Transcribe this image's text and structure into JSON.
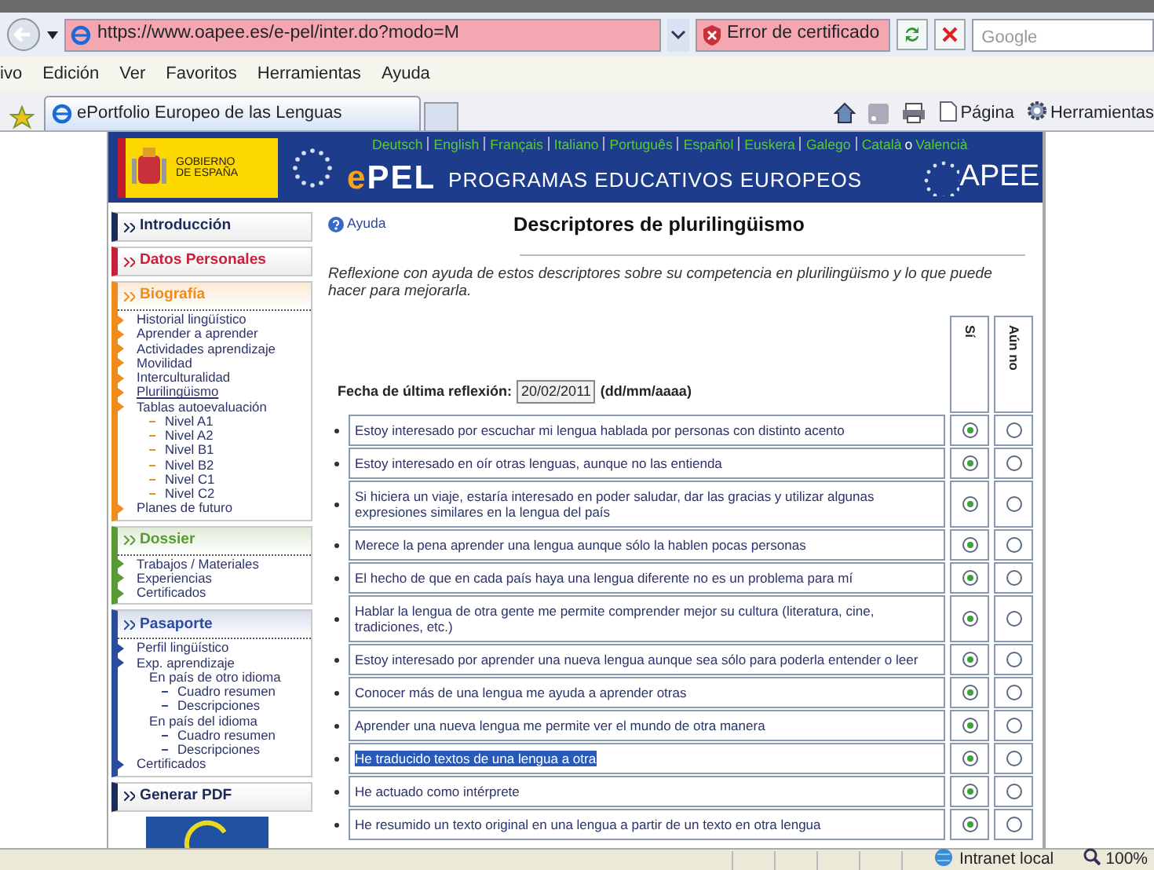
{
  "browser": {
    "address": "https://www.oapee.es/e-pel/inter.do?modo=M",
    "cert_error": "Error de certificado",
    "search_placeholder": "Google",
    "menu": [
      "ivo",
      "Edición",
      "Ver",
      "Favoritos",
      "Herramientas",
      "Ayuda"
    ],
    "tab_title": "ePortfolio Europeo de las Lenguas",
    "toolbar": [
      "Página",
      "Herramientas"
    ]
  },
  "banner": {
    "government": "GOBIERNO DE ESPAÑA",
    "languages": [
      "Deutsch",
      "English",
      "Français",
      "Italiano",
      "Português",
      "Español",
      "Euskera",
      "Galego",
      "Català"
    ],
    "alt_separator": "o",
    "alt_language": "Valencià",
    "logo": "ePEL",
    "title": "PROGRAMAS EDUCATIVOS EUROPEOS",
    "agency": "APEE"
  },
  "sidebar": [
    {
      "title": "Introducción",
      "color": "#1c2b5a"
    },
    {
      "title": "Datos Personales",
      "color": "#c8203c"
    },
    {
      "title": "Biografía",
      "color": "#f08c1e",
      "items": [
        {
          "label": "Historial lingüístico",
          "selected": false
        },
        {
          "label": "Aprender a aprender",
          "selected": false
        },
        {
          "label": "Actividades aprendizaje",
          "selected": false
        },
        {
          "label": "Movilidad",
          "selected": false
        },
        {
          "label": "Interculturalidad",
          "selected": false
        },
        {
          "label": "Plurilingüismo",
          "selected": true
        },
        {
          "label": "Tablas autoevaluación",
          "selected": false,
          "children": [
            {
              "label": "Nivel A1",
              "selected": false
            },
            {
              "label": "Nivel A2",
              "selected": false
            },
            {
              "label": "Nivel B1",
              "selected": false
            },
            {
              "label": "Nivel B2",
              "selected": false
            },
            {
              "label": "Nivel C1",
              "selected": false
            },
            {
              "label": "Nivel C2",
              "selected": false
            }
          ]
        },
        {
          "label": "Planes de futuro",
          "selected": false
        }
      ]
    },
    {
      "title": "Dossier",
      "color": "#5a9a34",
      "items": [
        {
          "label": "Trabajos / Materiales",
          "selected": false
        },
        {
          "label": "Experiencias",
          "selected": false
        },
        {
          "label": "Certificados",
          "selected": false
        }
      ]
    },
    {
      "title": "Pasaporte",
      "color": "#2a4ca0",
      "items": [
        {
          "label": "Perfil lingüístico",
          "selected": false
        },
        {
          "label": "Exp. aprendizaje",
          "selected": false,
          "children": [
            {
              "label": "En país de otro idioma",
              "selected": false,
              "children": [
                {
                  "label": "Cuadro resumen",
                  "selected": false
                },
                {
                  "label": "Descripciones",
                  "selected": false
                }
              ]
            },
            {
              "label": "En país del idioma",
              "selected": false,
              "children": [
                {
                  "label": "Cuadro resumen",
                  "selected": false
                },
                {
                  "label": "Descripciones",
                  "selected": false
                }
              ]
            }
          ]
        },
        {
          "label": "Certificados",
          "selected": false
        }
      ]
    },
    {
      "title": "Generar PDF",
      "color": "#1c2b5a"
    }
  ],
  "main": {
    "help": "Ayuda",
    "title": "Descriptores de plurilingüismo",
    "description": "Reflexione con ayuda de estos descriptores sobre su competencia en plurilingüismo y lo que puede hacer para mejorarla.",
    "date_label": "Fecha de última reflexión:",
    "date_value": "20/02/2011",
    "date_format": "(dd/mm/aaaa)",
    "columns": [
      "Sí",
      "Aún no"
    ],
    "rows": [
      {
        "text": "Estoy interesado por escuchar mi lengua hablada por personas con distinto acento",
        "yes": true,
        "highlighted": false
      },
      {
        "text": "Estoy interesado en oír otras lenguas, aunque no las entienda",
        "yes": true,
        "highlighted": false
      },
      {
        "text": "Si hiciera un viaje, estaría interesado en poder saludar, dar las gracias y utilizar algunas expresiones similares en la lengua del país",
        "yes": true,
        "highlighted": false
      },
      {
        "text": "Merece la pena aprender una lengua aunque sólo la hablen pocas personas",
        "yes": true,
        "highlighted": false
      },
      {
        "text": "El hecho de que en cada país haya una lengua diferente no es un problema para mí",
        "yes": true,
        "highlighted": false
      },
      {
        "text": "Hablar la lengua de otra gente me permite comprender mejor su cultura (literatura, cine, tradiciones, etc.)",
        "yes": true,
        "highlighted": false
      },
      {
        "text": "Estoy interesado por aprender una nueva lengua aunque sea sólo para poderla entender o leer",
        "yes": true,
        "highlighted": false
      },
      {
        "text": "Conocer más de una lengua me ayuda a aprender otras",
        "yes": true,
        "highlighted": false
      },
      {
        "text": "Aprender una nueva lengua me permite ver el mundo de otra manera",
        "yes": true,
        "highlighted": false
      },
      {
        "text": "He traducido textos de una lengua a otra",
        "yes": true,
        "highlighted": true
      },
      {
        "text": "He actuado como intérprete",
        "yes": true,
        "highlighted": false
      },
      {
        "text": "He resumido un texto original en una lengua a partir de un texto en otra lengua",
        "yes": true,
        "highlighted": false
      }
    ]
  },
  "status_bar": {
    "zone": "Intranet local",
    "zoom": "100%"
  }
}
